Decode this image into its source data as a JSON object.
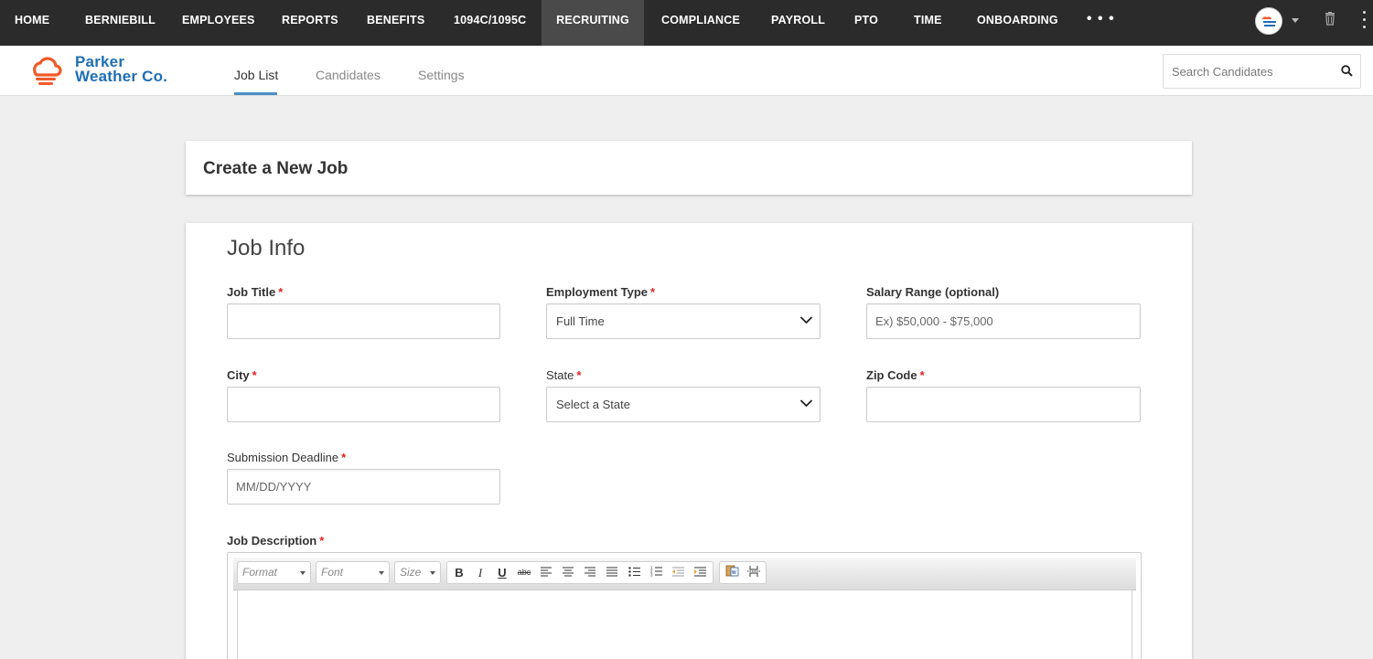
{
  "topnav": {
    "items": [
      "HOME",
      "BERNIEBILL",
      "EMPLOYEES",
      "REPORTS",
      "BENEFITS",
      "1094C/1095C",
      "RECRUITING",
      "COMPLIANCE",
      "PAYROLL",
      "PTO",
      "TIME",
      "ONBOARDING"
    ],
    "active": "RECRUITING",
    "more": "• • •"
  },
  "logo": {
    "line1": "Parker",
    "line2": "Weather Co."
  },
  "tabs": [
    "Job List",
    "Candidates",
    "Settings"
  ],
  "search": {
    "placeholder": "Search Candidates"
  },
  "page": {
    "title": "Create a New Job"
  },
  "job_info": {
    "section_title": "Job Info",
    "job_title_label": "Job Title",
    "employment_type_label": "Employment Type",
    "employment_type_value": "Full Time",
    "salary_label": "Salary Range (optional)",
    "salary_placeholder": "Ex) $50,000 - $75,000",
    "city_label": "City",
    "state_label": "State",
    "state_value": "Select a State",
    "zip_label": "Zip Code",
    "deadline_label": "Submission Deadline",
    "deadline_placeholder": "MM/DD/YYYY",
    "description_label": "Job Description",
    "required_mark": "*"
  },
  "editor": {
    "format_label": "Format",
    "font_label": "Font",
    "size_label": "Size"
  },
  "colors": {
    "topnav_bg": "#2b2b2b",
    "active_tab": "#4a8fc4",
    "required": "#e02424",
    "logo_blue": "#1e6fb5",
    "logo_orange": "#f05a28"
  }
}
